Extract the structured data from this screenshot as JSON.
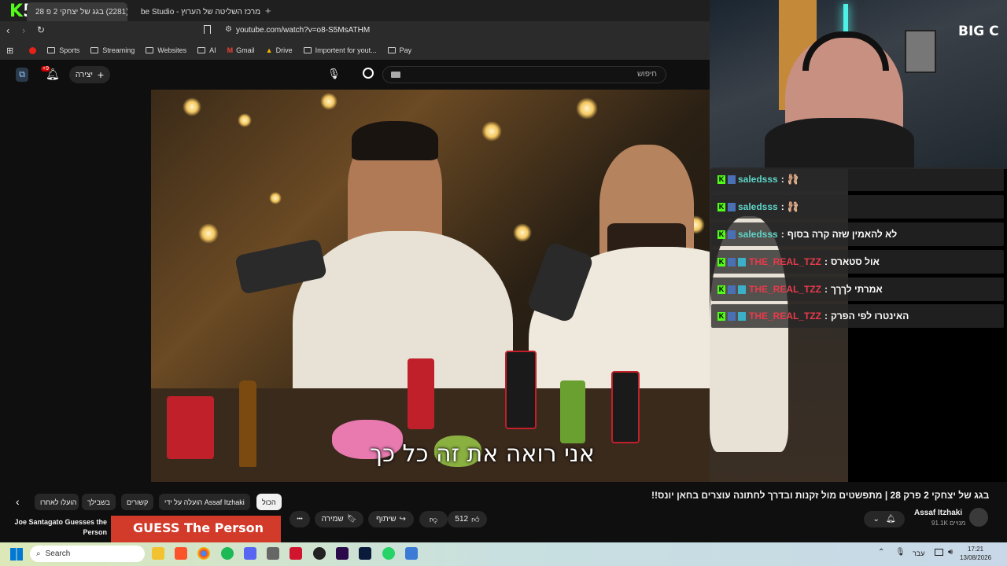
{
  "browser": {
    "overlay_logo": {
      "k": "K",
      "num": "5"
    },
    "tabs": [
      {
        "label": "(2281) בגג של יצחקי 2 פ 28"
      },
      {
        "label": "מרכז השליטה של הערוץ - be Studio"
      }
    ],
    "new_tab": "+",
    "url": "youtube.com/watch?v=o8-S5MsATHM",
    "bookmarks": [
      {
        "label": "Sports"
      },
      {
        "label": "Streaming"
      },
      {
        "label": "Websites"
      },
      {
        "label": "AI"
      },
      {
        "label": "Gmail"
      },
      {
        "label": "Drive"
      },
      {
        "label": "Importent for yout..."
      },
      {
        "label": "Pay"
      }
    ]
  },
  "youtube": {
    "search_placeholder": "חיפוש",
    "create_label": "יצירה",
    "notifications_badge": "+9",
    "subtitle": "אני רואה את זה כל כך",
    "video_title": "בגג של יצחקי 2 פרק 28 | מתפשטים מול זקנות ובדרך לחתונה עוצרים בחאן יונס!!",
    "channel": {
      "name": "Assaf Itzhaki",
      "subs": "91.1K מנויים"
    },
    "actions": {
      "likes": "512",
      "share": "שיתוף",
      "save": "שמירה",
      "more": "•••"
    },
    "chips": [
      {
        "label": "הכול"
      },
      {
        "label": "הועלה על ידי Assaf Itzhaki"
      },
      {
        "label": "קשורים"
      },
      {
        "label": "בשבילך"
      },
      {
        "label": "הועלו לאחרו"
      }
    ],
    "recommendation": {
      "title": "Joe Santagato Guesses the Person",
      "thumb_text": "GUESS The Person"
    }
  },
  "chat": [
    {
      "user": "saledsss",
      "message": "",
      "emote": "🩰",
      "color": "#5ed6c8"
    },
    {
      "user": "saledsss",
      "message": "",
      "emote": "🩰",
      "color": "#5ed6c8"
    },
    {
      "user": "saledsss",
      "message": "לא להאמין שזה קרה בסוף",
      "emote": "",
      "color": "#5ed6c8"
    },
    {
      "user": "THE_REAL_TZZ",
      "message": "אול סטארס",
      "emote": "",
      "color": "#e83a4a"
    },
    {
      "user": "THE_REAL_TZZ",
      "message": "אמרתי לךךך",
      "emote": "",
      "color": "#e83a4a"
    },
    {
      "user": "THE_REAL_TZZ",
      "message": "האינטרו לפי הפרק",
      "emote": "",
      "color": "#e83a4a"
    }
  ],
  "webcam": {
    "logo": "BIG C"
  },
  "taskbar": {
    "search_label": "Search",
    "lang": "עבר",
    "time": "17:21",
    "date": "13/08/2026"
  }
}
